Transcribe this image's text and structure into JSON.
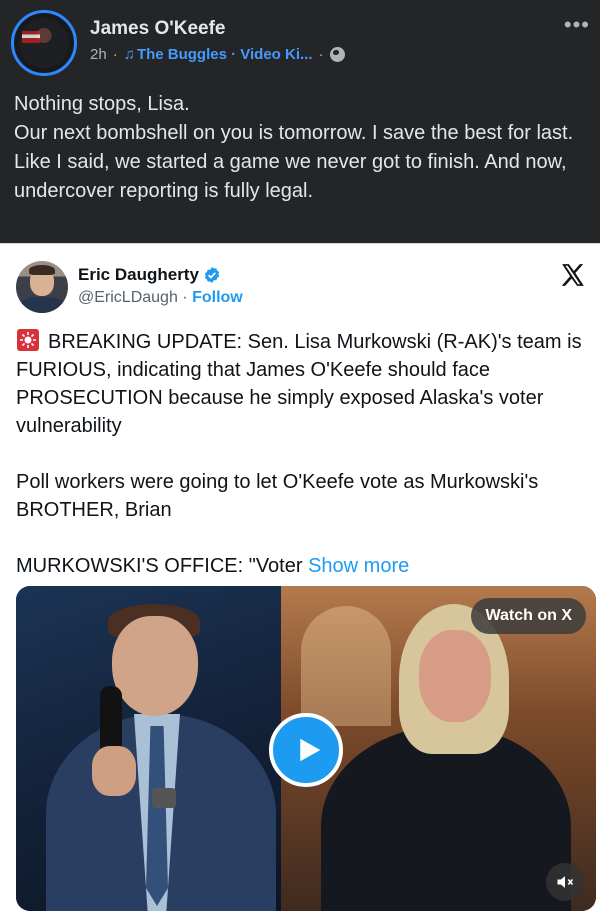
{
  "post": {
    "author": "James O'Keefe",
    "time": "2h",
    "music_link": "The Buggles · Video Ki...",
    "audience_icon": "globe-icon",
    "text_lines": [
      "Nothing stops, Lisa.",
      "Our next bombshell on you is tomorrow. I save the best for last.",
      "Like I said, we started a game we never got to finish. And now, undercover reporting is fully legal."
    ]
  },
  "tweet": {
    "name": "Eric Daugherty",
    "handle": "@EricLDaugh",
    "follow_label": "Follow",
    "separator": "·",
    "paragraphs": [
      "BREAKING UPDATE: Sen. Lisa Murkowski (R-AK)'s team is FURIOUS, indicating that James O'Keefe should face PROSECUTION because he simply exposed Alaska's voter vulnerability",
      "Poll workers were going to let O'Keefe vote as Murkowski's BROTHER, Brian",
      "MURKOWSKI'S OFFICE: \"Voter"
    ],
    "show_more_label": "Show more",
    "media": {
      "watch_label": "Watch on X"
    }
  },
  "colors": {
    "facebook_bg": "#242526",
    "facebook_link": "#4599ff",
    "x_blue": "#1d9bf0"
  }
}
